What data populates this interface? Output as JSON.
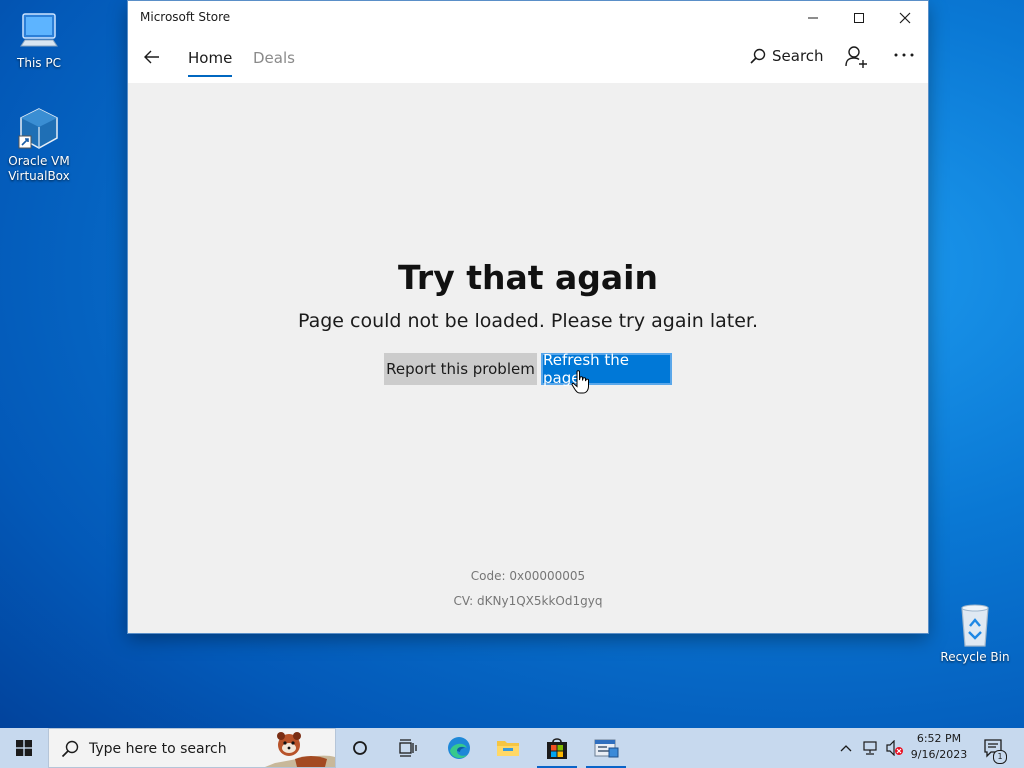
{
  "desktop": {
    "icons": [
      {
        "label": "This PC"
      },
      {
        "label": "Oracle VM VirtualBox"
      },
      {
        "label": "Recycle Bin"
      }
    ]
  },
  "window": {
    "title": "Microsoft Store",
    "nav": {
      "tabs": [
        {
          "label": "Home",
          "active": true
        },
        {
          "label": "Deals",
          "active": false
        }
      ],
      "search_label": "Search"
    },
    "error": {
      "title": "Try that again",
      "message": "Page could not be loaded. Please try again later.",
      "report_button": "Report this problem",
      "refresh_button": "Refresh the page",
      "code": "Code: 0x00000005",
      "cv": "CV: dKNy1QX5kkOd1gyq"
    }
  },
  "taskbar": {
    "search_placeholder": "Type here to search",
    "time": "6:52 PM",
    "date": "9/16/2023",
    "notification_count": "1"
  },
  "colors": {
    "accent": "#0078d7",
    "tab_underline": "#0067c0",
    "window_bg": "#f0f0f0"
  }
}
